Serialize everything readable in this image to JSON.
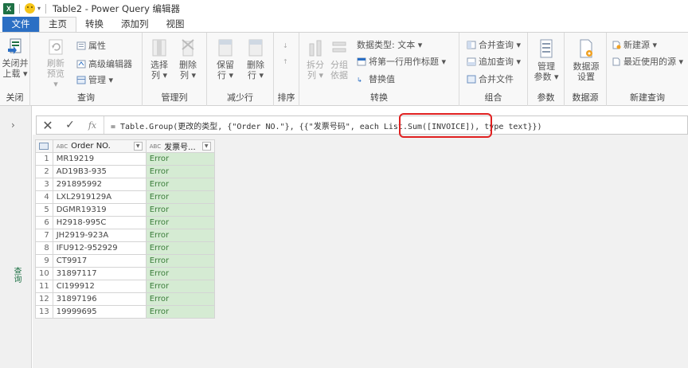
{
  "titlebar": {
    "app_icon": "X",
    "quick_access_arrow": "▾",
    "title": "Table2 - Power Query 编辑器"
  },
  "tabs": [
    {
      "label": "文件"
    },
    {
      "label": "主页"
    },
    {
      "label": "转换"
    },
    {
      "label": "添加列"
    },
    {
      "label": "视图"
    }
  ],
  "ribbon": {
    "close": {
      "btn1_l1": "关闭并",
      "btn1_l2": "上载 ▾",
      "group_label": "关闭"
    },
    "query": {
      "refresh_l1": "刷新",
      "refresh_l2": "预览 ▾",
      "properties": "属性",
      "advanced_editor": "高级编辑器",
      "manage": "管理 ▾",
      "group_label": "查询"
    },
    "manage_cols": {
      "select_l1": "选择",
      "select_l2": "列 ▾",
      "remove_l1": "删除",
      "remove_l2": "列 ▾",
      "group_label": "管理列"
    },
    "reduce_rows": {
      "keep_l1": "保留",
      "keep_l2": "行 ▾",
      "remove_l1": "删除",
      "remove_l2": "行 ▾",
      "group_label": "减少行"
    },
    "sort": {
      "group_label": "排序"
    },
    "transform": {
      "split_l1": "拆分",
      "split_l2": "列 ▾",
      "group_l1": "分组",
      "group_l2": "依据",
      "data_type": "数据类型: 文本 ▾",
      "first_row_header": "将第一行用作标题 ▾",
      "replace_values": "替换值",
      "group_label": "转换"
    },
    "combine": {
      "merge": "合并查询 ▾",
      "append": "追加查询 ▾",
      "combine_files": "合并文件",
      "group_label": "组合"
    },
    "params": {
      "manage_l1": "管理",
      "manage_l2": "参数 ▾",
      "group_label": "参数"
    },
    "datasource": {
      "settings_l1": "数据源",
      "settings_l2": "设置",
      "group_label": "数据源"
    },
    "new_query": {
      "new_source": "新建源 ▾",
      "recent_sources": "最近使用的源 ▾",
      "group_label": "新建查询"
    }
  },
  "left_pane": {
    "chevron": "›",
    "label": "查询"
  },
  "formula_bar": {
    "cancel": "✕",
    "commit": "✓",
    "fx": "fx",
    "formula": "= Table.Group(更改的类型, {\"Order NO.\"}, {{\"发票号码\", each List.Sum([INVOICE]), type text}})"
  },
  "grid": {
    "type_icon": "ABC",
    "columns": [
      {
        "label": "Order NO."
      },
      {
        "label": "发票号..."
      }
    ],
    "rows": [
      {
        "n": "1",
        "order": "MR19219",
        "invoice": "Error"
      },
      {
        "n": "2",
        "order": "AD19B3-935",
        "invoice": "Error"
      },
      {
        "n": "3",
        "order": "291895992",
        "invoice": "Error"
      },
      {
        "n": "4",
        "order": "LXL2919129A",
        "invoice": "Error"
      },
      {
        "n": "5",
        "order": "DGMR19319",
        "invoice": "Error"
      },
      {
        "n": "6",
        "order": "H2918-995C",
        "invoice": "Error"
      },
      {
        "n": "7",
        "order": "JH2919-923A",
        "invoice": "Error"
      },
      {
        "n": "8",
        "order": "IFU912-952929",
        "invoice": "Error"
      },
      {
        "n": "9",
        "order": "CT9917",
        "invoice": "Error"
      },
      {
        "n": "10",
        "order": "31897117",
        "invoice": "Error"
      },
      {
        "n": "11",
        "order": "CI199912",
        "invoice": "Error"
      },
      {
        "n": "12",
        "order": "31897196",
        "invoice": "Error"
      },
      {
        "n": "13",
        "order": "19999695",
        "invoice": "Error"
      }
    ]
  },
  "colors": {
    "accent": "#2b6fc4",
    "error_fill": "#d5ebd3",
    "error_text": "#3a7d3a",
    "highlight": "#e02020"
  }
}
